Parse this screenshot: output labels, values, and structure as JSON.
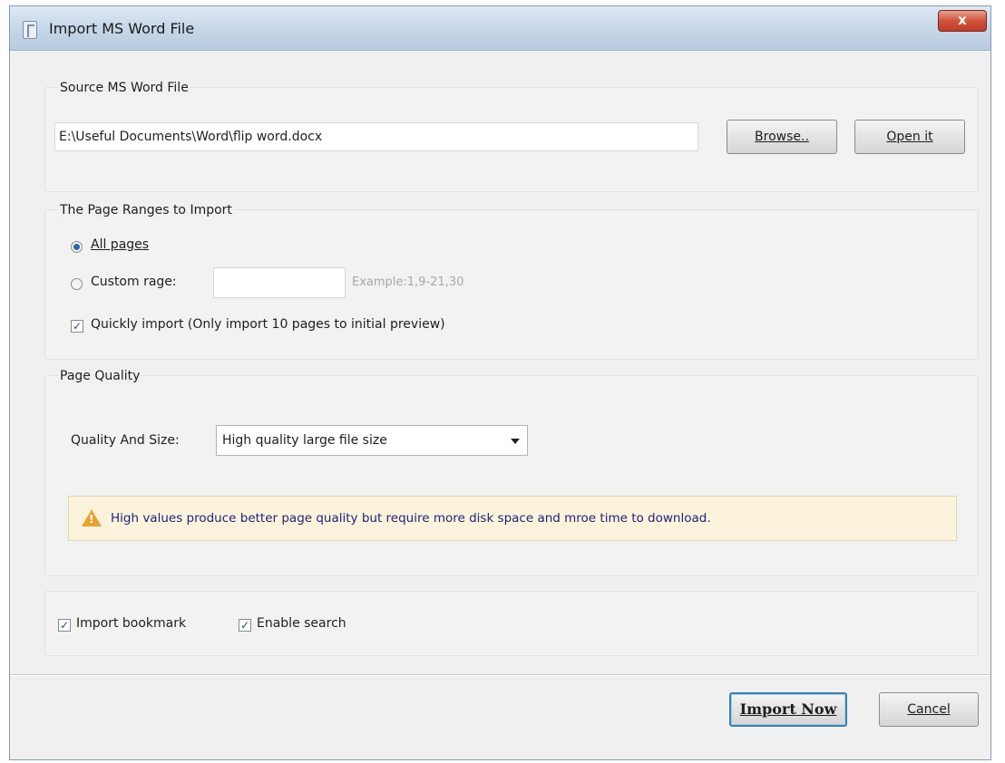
{
  "window": {
    "title": "Import MS Word File",
    "close_glyph": "x"
  },
  "source": {
    "group_label": "Source MS Word File",
    "file_path": "E:\\Useful Documents\\Word\\flip word.docx",
    "browse_label": "Browse..",
    "open_label": "Open it"
  },
  "ranges": {
    "group_label": "The Page Ranges to Import",
    "all_pages_label": "All pages",
    "all_pages_selected": true,
    "custom_label": "Custom rage:",
    "custom_value": "",
    "custom_hint": "Example:1,9-21,30",
    "quick_import_label": "Quickly import (Only import 10 pages to  initial  preview)",
    "quick_import_checked": true
  },
  "quality": {
    "group_label": "Page Quality",
    "size_label": "Quality And Size:",
    "selected_option": "High quality large file size",
    "warning_text": "High values produce better page quality but require more disk space and mroe time to download."
  },
  "options": {
    "import_bookmark_label": "Import bookmark",
    "import_bookmark_checked": true,
    "enable_search_label": "Enable search",
    "enable_search_checked": true
  },
  "footer": {
    "import_label": "Import Now",
    "cancel_label": "Cancel"
  },
  "colors": {
    "warning_text": "#22237a",
    "warning_bg": "#fbf3dc",
    "primary_border": "#3c7fb1"
  }
}
